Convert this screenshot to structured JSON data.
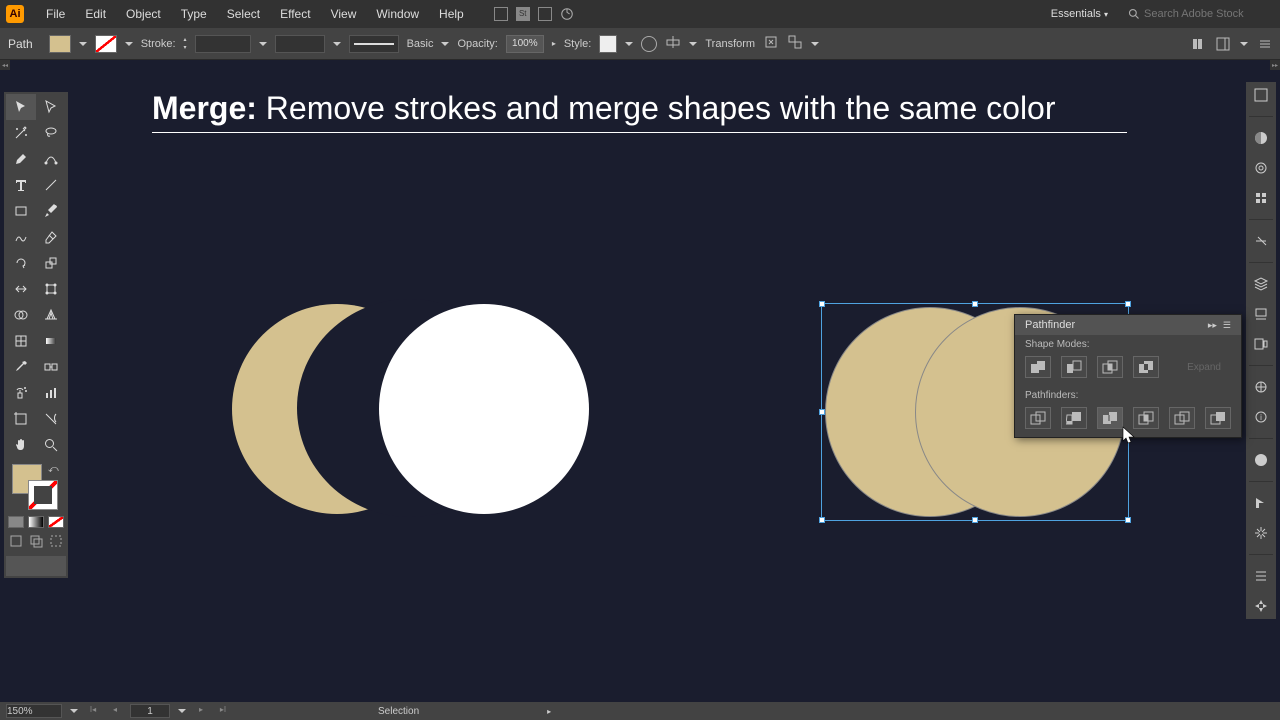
{
  "menubar": {
    "items": [
      "File",
      "Edit",
      "Object",
      "Type",
      "Select",
      "Effect",
      "View",
      "Window",
      "Help"
    ],
    "workspace": "Essentials",
    "search_placeholder": "Search Adobe Stock"
  },
  "controlbar": {
    "selection_label": "Path",
    "stroke_label": "Stroke:",
    "brush_label": "Basic",
    "opacity_label": "Opacity:",
    "opacity_value": "100%",
    "style_label": "Style:",
    "transform_label": "Transform"
  },
  "annotation": {
    "bold": "Merge:",
    "rest": " Remove strokes and merge shapes with the same color"
  },
  "pathfinder": {
    "title": "Pathfinder",
    "shape_modes_label": "Shape Modes:",
    "pathfinders_label": "Pathfinders:",
    "expand_label": "Expand"
  },
  "statusbar": {
    "zoom": "150%",
    "artboard": "1",
    "tool": "Selection"
  },
  "colors": {
    "tan": "#d4c18f",
    "canvas_bg": "#1a1d2e"
  }
}
